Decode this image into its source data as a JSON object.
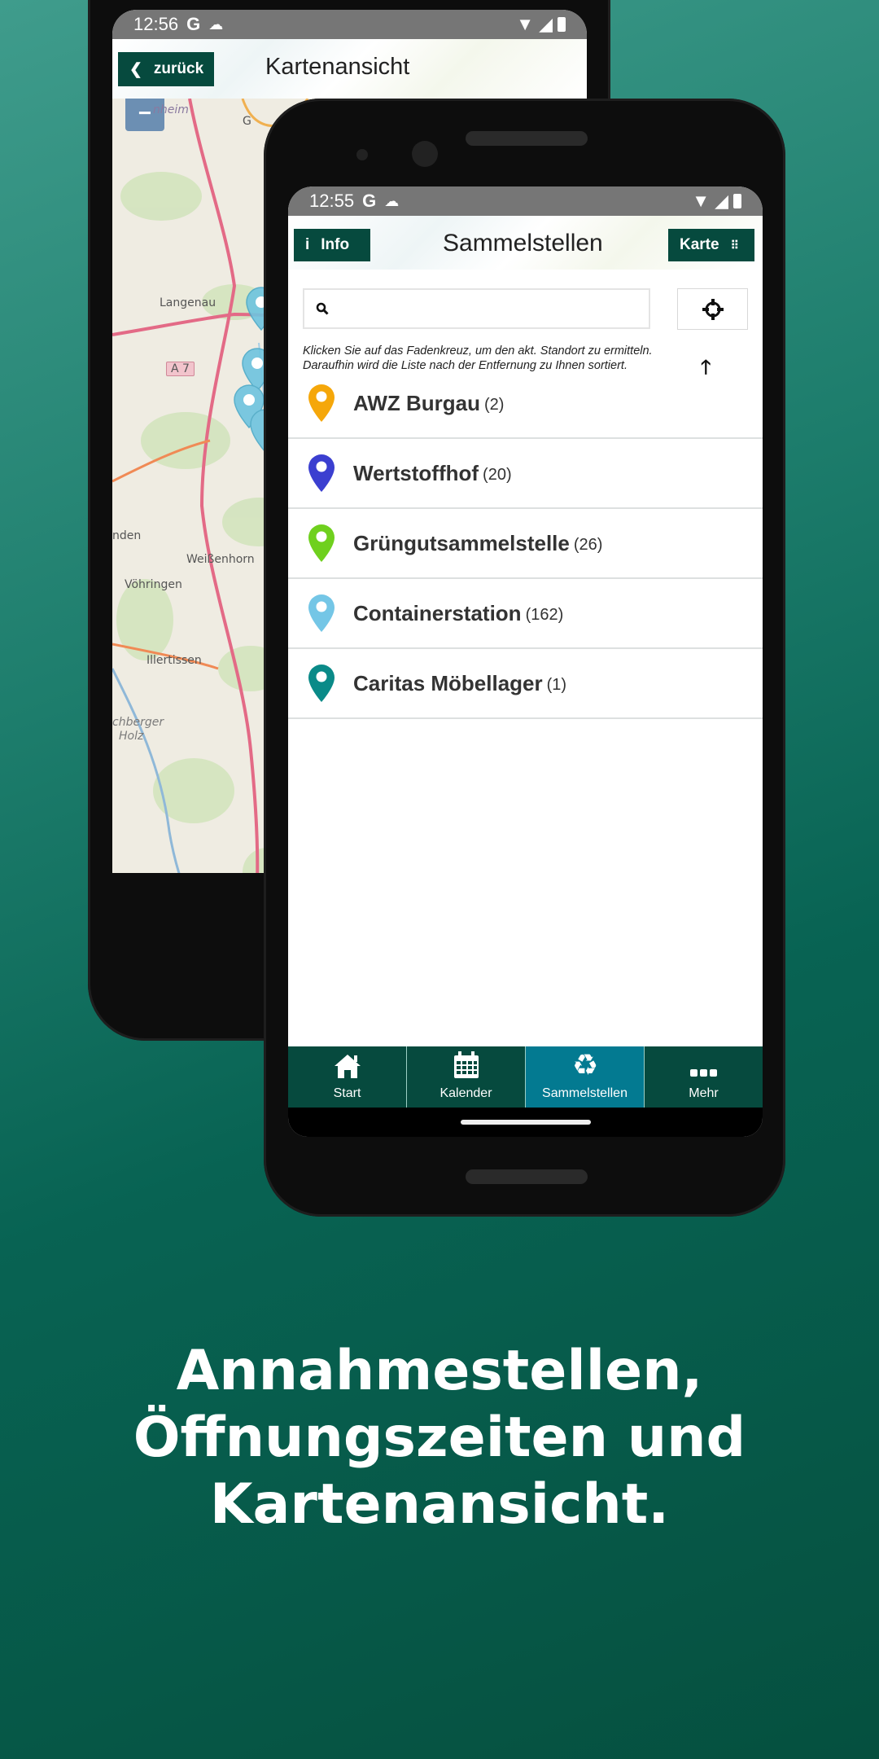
{
  "back_phone": {
    "status": {
      "time": "12:56",
      "g": "G"
    },
    "header": {
      "back_label": "zurück",
      "title": "Kartenansicht"
    },
    "map": {
      "zoom_out_label": "−",
      "labels": [
        "Langenau",
        "A 7",
        "Weißenhorn",
        "Vöhringen",
        "Illertissen",
        "nden",
        "chberger",
        "Holz",
        "nheim",
        "G"
      ]
    }
  },
  "front_phone": {
    "status": {
      "time": "12:55",
      "g": "G"
    },
    "header": {
      "info_label": "Info",
      "title": "Sammelstellen",
      "map_label": "Karte"
    },
    "search": {
      "placeholder": "",
      "value": ""
    },
    "hint": "Klicken Sie auf das Fadenkreuz, um den akt. Standort zu ermitteln. Daraufhin wird die Liste nach der Entfernung zu Ihnen sortiert.",
    "list": [
      {
        "name": "AWZ Burgau",
        "count": "(2)",
        "color": "#f5a70a"
      },
      {
        "name": "Wertstoffhof",
        "count": "(20)",
        "color": "#3b3fd0"
      },
      {
        "name": "Grüngutsammelstelle",
        "count": "(26)",
        "color": "#6fd01e"
      },
      {
        "name": "Containerstation",
        "count": "(162)",
        "color": "#74c6e6"
      },
      {
        "name": "Caritas Möbellager",
        "count": "(1)",
        "color": "#0a8a88"
      }
    ],
    "nav": [
      {
        "label": "Start",
        "icon": "home-icon"
      },
      {
        "label": "Kalender",
        "icon": "calendar-icon"
      },
      {
        "label": "Sammelstellen",
        "icon": "recycle-icon",
        "active": true
      },
      {
        "label": "Mehr",
        "icon": "more-icon"
      }
    ]
  },
  "colors": {
    "primary": "#064a3e",
    "active_tab": "#037a91",
    "status_bar": "#767676"
  },
  "caption": [
    "Annahmestellen,",
    "Öffnungszeiten und",
    "Kartenansicht."
  ]
}
